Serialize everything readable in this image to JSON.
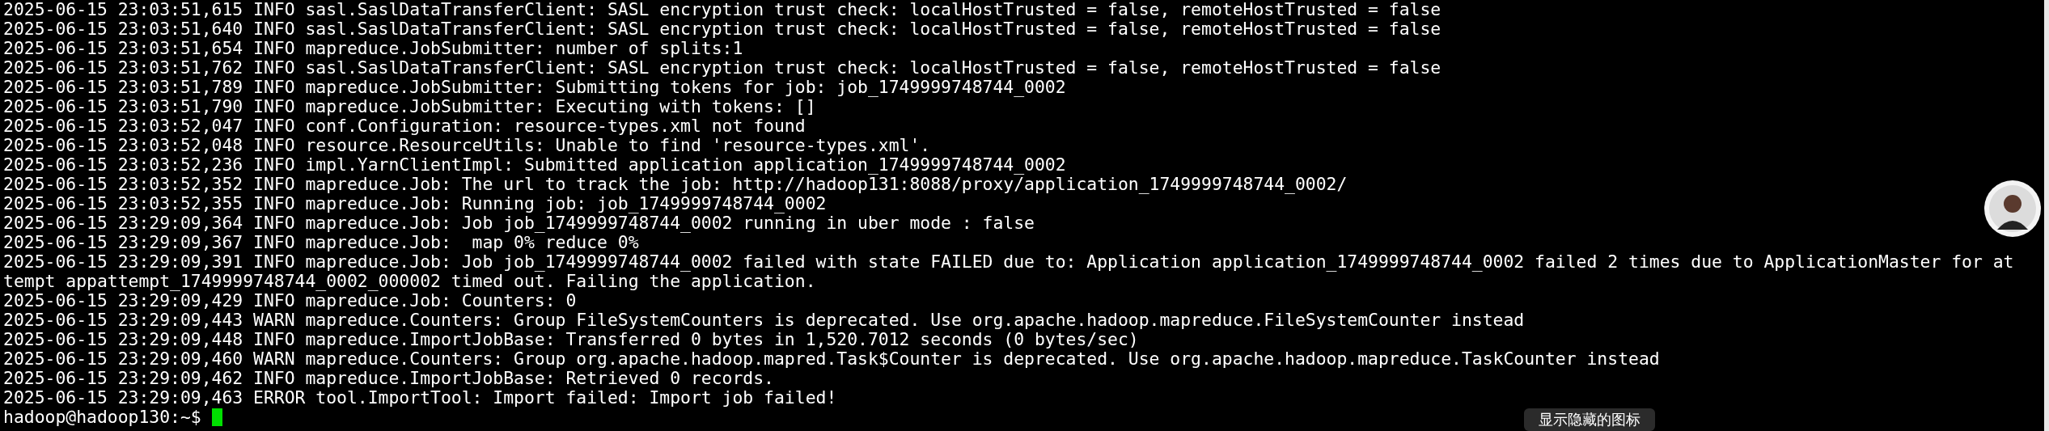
{
  "log_lines": [
    "2025-06-15 23:03:51,615 INFO sasl.SaslDataTransferClient: SASL encryption trust check: localHostTrusted = false, remoteHostTrusted = false",
    "2025-06-15 23:03:51,640 INFO sasl.SaslDataTransferClient: SASL encryption trust check: localHostTrusted = false, remoteHostTrusted = false",
    "2025-06-15 23:03:51,654 INFO mapreduce.JobSubmitter: number of splits:1",
    "2025-06-15 23:03:51,762 INFO sasl.SaslDataTransferClient: SASL encryption trust check: localHostTrusted = false, remoteHostTrusted = false",
    "2025-06-15 23:03:51,789 INFO mapreduce.JobSubmitter: Submitting tokens for job: job_1749999748744_0002",
    "2025-06-15 23:03:51,790 INFO mapreduce.JobSubmitter: Executing with tokens: []",
    "2025-06-15 23:03:52,047 INFO conf.Configuration: resource-types.xml not found",
    "2025-06-15 23:03:52,048 INFO resource.ResourceUtils: Unable to find 'resource-types.xml'.",
    "2025-06-15 23:03:52,236 INFO impl.YarnClientImpl: Submitted application application_1749999748744_0002",
    "2025-06-15 23:03:52,352 INFO mapreduce.Job: The url to track the job: http://hadoop131:8088/proxy/application_1749999748744_0002/",
    "2025-06-15 23:03:52,355 INFO mapreduce.Job: Running job: job_1749999748744_0002",
    "2025-06-15 23:29:09,364 INFO mapreduce.Job: Job job_1749999748744_0002 running in uber mode : false",
    "2025-06-15 23:29:09,367 INFO mapreduce.Job:  map 0% reduce 0%",
    "2025-06-15 23:29:09,391 INFO mapreduce.Job: Job job_1749999748744_0002 failed with state FAILED due to: Application application_1749999748744_0002 failed 2 times due to ApplicationMaster for at",
    "tempt appattempt_1749999748744_0002_000002 timed out. Failing the application.",
    "2025-06-15 23:29:09,429 INFO mapreduce.Job: Counters: 0",
    "2025-06-15 23:29:09,443 WARN mapreduce.Counters: Group FileSystemCounters is deprecated. Use org.apache.hadoop.mapreduce.FileSystemCounter instead",
    "2025-06-15 23:29:09,448 INFO mapreduce.ImportJobBase: Transferred 0 bytes in 1,520.7012 seconds (0 bytes/sec)",
    "2025-06-15 23:29:09,460 WARN mapreduce.Counters: Group org.apache.hadoop.mapred.Task$Counter is deprecated. Use org.apache.hadoop.mapreduce.TaskCounter instead",
    "2025-06-15 23:29:09,462 INFO mapreduce.ImportJobBase: Retrieved 0 records.",
    "2025-06-15 23:29:09,463 ERROR tool.ImportTool: Import failed: Import job failed!"
  ],
  "prompt": "hadoop@hadoop130:~$",
  "tooltip": "显示隐藏的图标"
}
